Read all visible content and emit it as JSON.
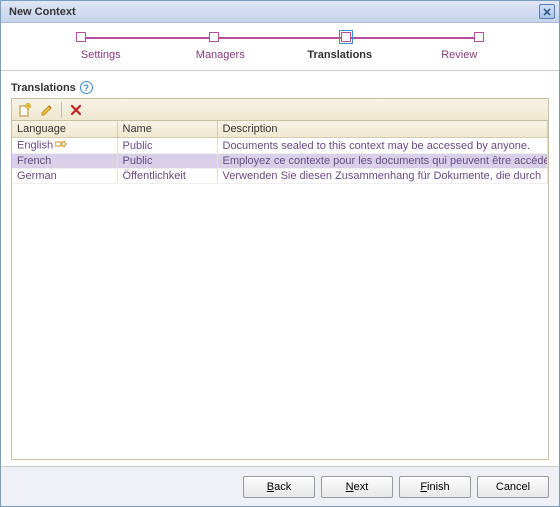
{
  "title": "New Context",
  "steps": [
    {
      "label": "Settings",
      "current": false
    },
    {
      "label": "Managers",
      "current": false
    },
    {
      "label": "Translations",
      "current": true
    },
    {
      "label": "Review",
      "current": false
    }
  ],
  "section_title": "Translations",
  "columns": {
    "c1": "Language",
    "c2": "Name",
    "c3": "Description"
  },
  "rows": [
    {
      "language": "English",
      "default": true,
      "name": "Public",
      "description": "Documents sealed to this context may be accessed by anyone.",
      "selected": false
    },
    {
      "language": "French",
      "default": false,
      "name": "Public",
      "description": "Employez ce contexte pour les documents qui peuvent être accédés",
      "selected": true
    },
    {
      "language": "German",
      "default": false,
      "name": "Öffentlichkeit",
      "description": "Verwenden Sie diesen Zusammenhang für Dokumente, die durch",
      "selected": false
    }
  ],
  "buttons": {
    "back": "Back",
    "next": "Next",
    "finish": "Finish",
    "cancel": "Cancel"
  }
}
